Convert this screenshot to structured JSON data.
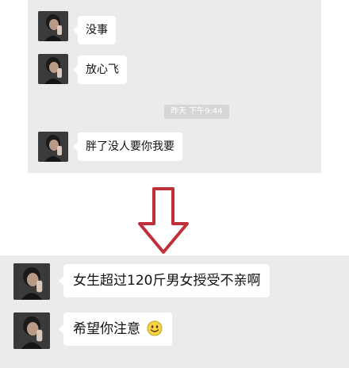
{
  "top_chat": {
    "messages": [
      {
        "text": "没事"
      },
      {
        "text": "放心飞"
      },
      {
        "text": "胖了没人要你我要"
      }
    ],
    "timestamp": "昨天 下午9:44"
  },
  "bottom_chat": {
    "messages": [
      {
        "text": "女生超过120斤男女授受不亲啊"
      },
      {
        "text": "希望你注意",
        "emoji": "smile-emoji-icon"
      }
    ]
  },
  "colors": {
    "chat_background": "#ebebeb",
    "bubble": "#ffffff",
    "arrow_stroke": "#c0303a",
    "timestamp_pill": "#d6d6d6"
  }
}
